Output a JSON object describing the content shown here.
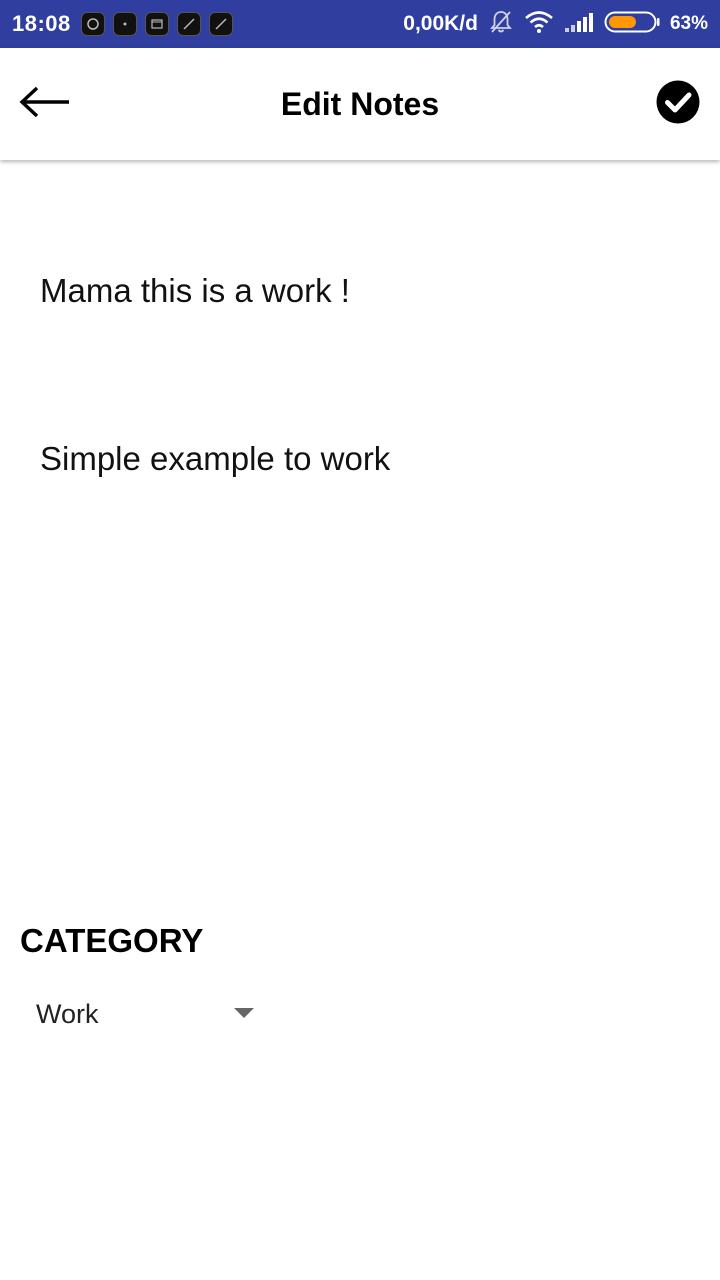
{
  "status_bar": {
    "time": "18:08",
    "network_speed": "0,00K/d",
    "battery_percent": "63%",
    "battery_level": 0.63,
    "background_color": "#303F9F",
    "icons": [
      "notification-icon",
      "notification-icon",
      "notification-icon",
      "notification-icon",
      "notification-icon",
      "bell-off-icon",
      "wifi-icon",
      "signal-icon",
      "battery-icon"
    ]
  },
  "app_bar": {
    "title": "Edit Notes",
    "back_icon": "arrow-left-icon",
    "done_icon": "check-circle-icon"
  },
  "note": {
    "title": "Mama this is a work !",
    "body": "Simple example to work"
  },
  "category": {
    "label": "CATEGORY",
    "selected": "Work",
    "caret_icon": "caret-down-icon"
  }
}
